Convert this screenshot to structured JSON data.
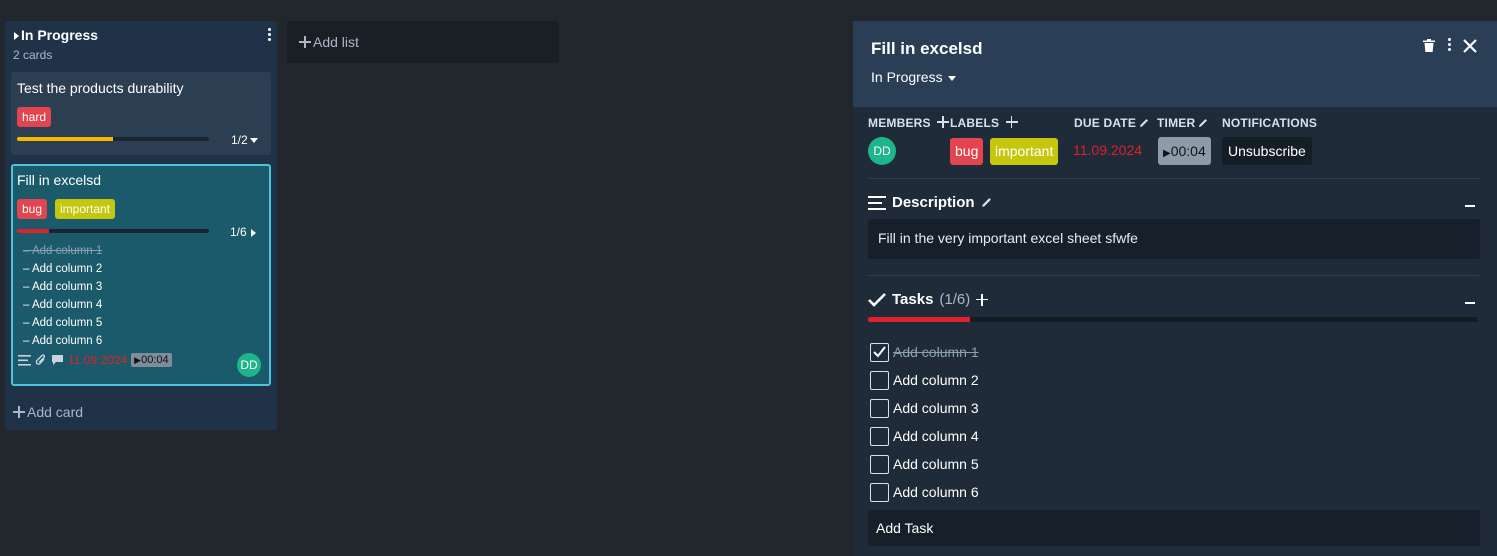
{
  "list": {
    "title": "In Progress",
    "count": "2 cards",
    "add_card": "Add card"
  },
  "add_list": "Add list",
  "cards": [
    {
      "title": "Test the products durability",
      "labels": [
        "hard"
      ],
      "progress": 0.5,
      "task_count": "1/2",
      "progress_color": "#f5b800"
    },
    {
      "title": "Fill in excelsd",
      "labels": [
        "bug",
        "important"
      ],
      "progress": 0.1667,
      "task_count": "1/6",
      "progress_color": "#e0202a",
      "tasks": [
        "Add column 1",
        "Add column 2",
        "Add column 3",
        "Add column 4",
        "Add column 5",
        "Add column 6"
      ],
      "due": "11.09.2024",
      "timer": "00:04",
      "member": "DD"
    }
  ],
  "panel": {
    "title": "Fill in excelsd",
    "status": "In Progress",
    "members_label": "MEMBERS",
    "labels_label": "LABELS",
    "due_label": "DUE DATE",
    "timer_label": "TIMER",
    "notifications_label": "NOTIFICATIONS",
    "member": "DD",
    "labels": [
      "bug",
      "important"
    ],
    "due": "11.09.2024",
    "timer": "00:04",
    "unsubscribe": "Unsubscribe",
    "description_title": "Description",
    "description": "Fill in the very important excel sheet sfwfe",
    "tasks_title": "Tasks",
    "tasks_count": "(1/6)",
    "tasks_progress": 0.1667,
    "tasks": [
      {
        "label": "Add column 1",
        "done": true
      },
      {
        "label": "Add column 2",
        "done": false
      },
      {
        "label": "Add column 3",
        "done": false
      },
      {
        "label": "Add column 4",
        "done": false
      },
      {
        "label": "Add column 5",
        "done": false
      },
      {
        "label": "Add column 6",
        "done": false
      }
    ],
    "add_task": "Add Task"
  },
  "colors": {
    "label_red": "#e2454f",
    "label_yellow": "#c5c70e",
    "avatar": "#1fb58a",
    "due": "#e0202a"
  }
}
